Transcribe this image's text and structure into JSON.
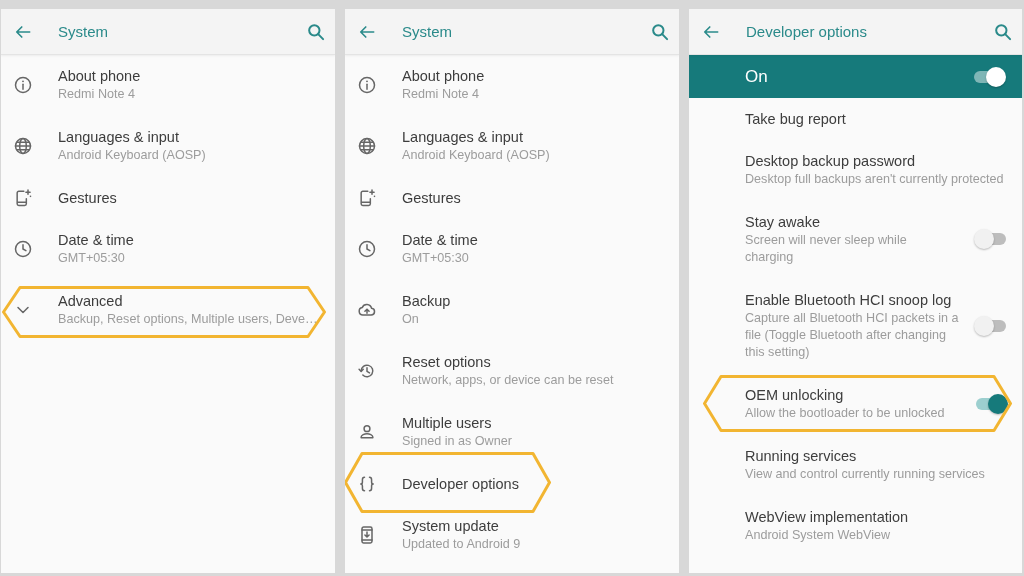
{
  "panels": [
    {
      "title": "System",
      "items": [
        {
          "kind": "setting",
          "title": "About phone",
          "subtitle": "Redmi Note 4",
          "highlighted": false
        },
        {
          "kind": "setting",
          "title": "Languages & input",
          "subtitle": "Android Keyboard (AOSP)",
          "highlighted": false
        },
        {
          "kind": "setting",
          "title": "Gestures",
          "highlighted": false
        },
        {
          "kind": "setting",
          "title": "Date & time",
          "subtitle": "GMT+05:30",
          "highlighted": false
        },
        {
          "kind": "expander",
          "title": "Advanced",
          "subtitle": "Backup, Reset options, Multiple users, Deve…",
          "expanded": false,
          "highlighted": true
        }
      ]
    },
    {
      "title": "System",
      "items": [
        {
          "kind": "setting",
          "title": "About phone",
          "subtitle": "Redmi Note 4",
          "highlighted": false
        },
        {
          "kind": "setting",
          "title": "Languages & input",
          "subtitle": "Android Keyboard (AOSP)",
          "highlighted": false
        },
        {
          "kind": "setting",
          "title": "Gestures",
          "highlighted": false
        },
        {
          "kind": "setting",
          "title": "Date & time",
          "subtitle": "GMT+05:30",
          "highlighted": false
        },
        {
          "kind": "setting",
          "title": "Backup",
          "subtitle": "On",
          "highlighted": false
        },
        {
          "kind": "setting",
          "title": "Reset options",
          "subtitle": "Network, apps, or device can be reset",
          "highlighted": false
        },
        {
          "kind": "setting",
          "title": "Multiple users",
          "subtitle": "Signed in as Owner",
          "highlighted": false
        },
        {
          "kind": "setting",
          "title": "Developer options",
          "highlighted": true
        },
        {
          "kind": "setting",
          "title": "System update",
          "subtitle": "Updated to Android 9",
          "highlighted": false
        }
      ]
    },
    {
      "title": "Developer options",
      "master_switch": {
        "label": "On",
        "on": true
      },
      "items": [
        {
          "kind": "plain",
          "title": "Take bug report",
          "highlighted": false
        },
        {
          "kind": "plain",
          "title": "Desktop backup password",
          "subtitle": "Desktop full backups aren't currently protected",
          "highlighted": false
        },
        {
          "kind": "switch",
          "title": "Stay awake",
          "subtitle": "Screen will never sleep while charging",
          "on": false,
          "highlighted": false
        },
        {
          "kind": "switch",
          "title": "Enable Bluetooth HCI snoop log",
          "subtitle": "Capture all Bluetooth HCI packets in a file (Toggle Bluetooth after changing this setting)",
          "on": false,
          "highlighted": false
        },
        {
          "kind": "switch",
          "title": "OEM unlocking",
          "subtitle": "Allow the bootloader to be unlocked",
          "on": true,
          "highlighted": true
        },
        {
          "kind": "plain",
          "title": "Running services",
          "subtitle": "View and control currently running services",
          "highlighted": false
        },
        {
          "kind": "plain",
          "title": "WebView implementation",
          "subtitle": "Android System WebView",
          "highlighted": false
        }
      ]
    }
  ]
}
